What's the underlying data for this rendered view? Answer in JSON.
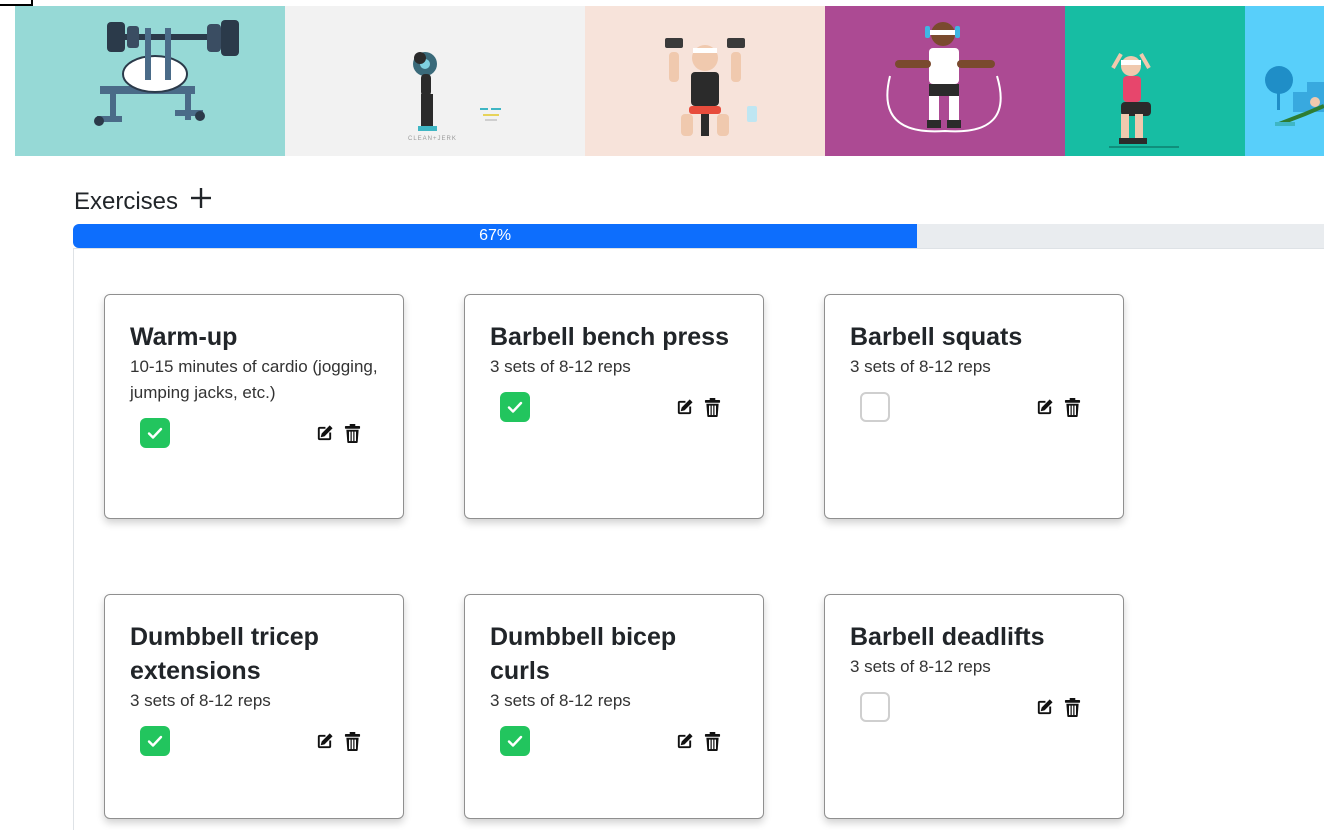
{
  "banner": {
    "tiles": [
      {
        "name": "bench-press-illustration",
        "bg": "#96d9d6"
      },
      {
        "name": "clean-and-jerk-illustration",
        "bg": "#f2f2f2",
        "caption": "CLEAN+JERK"
      },
      {
        "name": "dumbbell-press-illustration",
        "bg": "#f7e3da"
      },
      {
        "name": "jump-rope-illustration",
        "bg": "#ac4a93"
      },
      {
        "name": "squat-illustration",
        "bg": "#17bda3"
      },
      {
        "name": "stretch-illustration",
        "bg": "#58cffa"
      }
    ]
  },
  "header": {
    "title": "Exercises",
    "add_icon": "plus-icon"
  },
  "progress": {
    "percent": 67,
    "label": "67%",
    "color": "#0d6efd"
  },
  "exercises": [
    {
      "title": "Warm-up",
      "description": "10-15 minutes of cardio (jogging, jumping jacks, etc.)",
      "done": true
    },
    {
      "title": "Barbell bench press",
      "description": "3 sets of 8-12 reps",
      "done": true
    },
    {
      "title": "Barbell squats",
      "description": "3 sets of 8-12 reps",
      "done": false
    },
    {
      "title": "Dumbbell tricep extensions",
      "description": "3 sets of 8-12 reps",
      "done": true
    },
    {
      "title": "Dumbbell bicep curls",
      "description": "3 sets of 8-12 reps",
      "done": true
    },
    {
      "title": "Barbell deadlifts",
      "description": "3 sets of 8-12 reps",
      "done": false
    }
  ],
  "icons": {
    "edit": "edit-icon",
    "delete": "trash-icon",
    "check": "check-icon"
  },
  "colors": {
    "check_done": "#22c55e",
    "check_empty_border": "#cfcfcf"
  }
}
